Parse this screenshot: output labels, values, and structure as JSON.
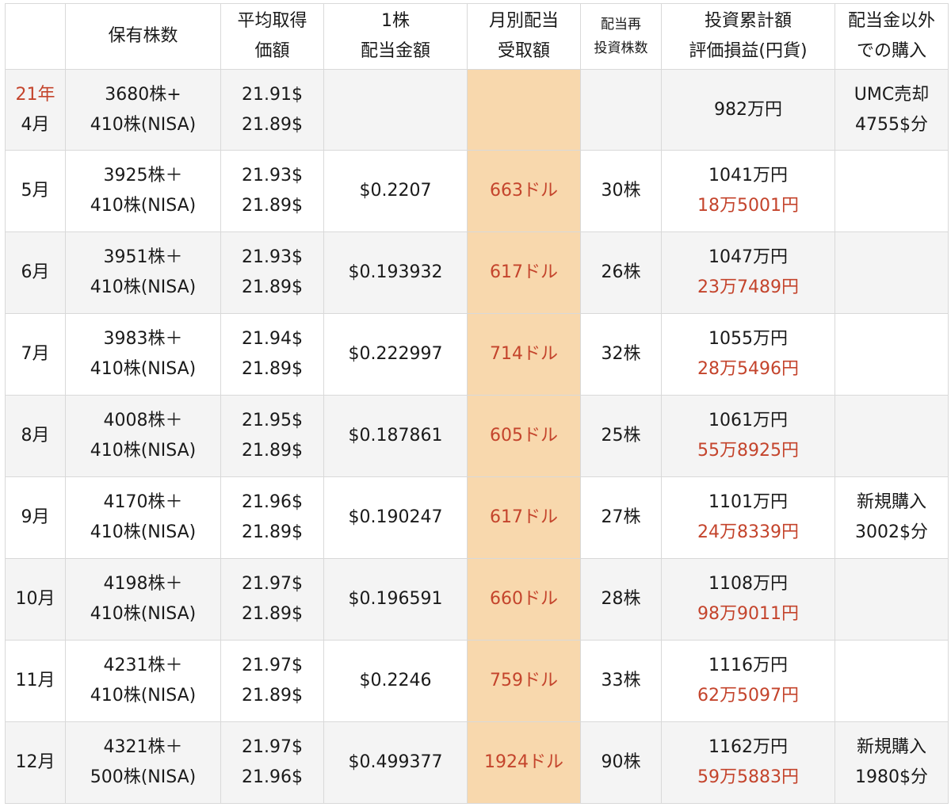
{
  "table": {
    "headers": [
      {
        "lines": [
          ""
        ]
      },
      {
        "lines": [
          "保有株数"
        ]
      },
      {
        "lines": [
          "平均取得",
          "価額"
        ]
      },
      {
        "lines": [
          "1株",
          "配当金額"
        ]
      },
      {
        "lines": [
          "月別配当",
          "受取額"
        ]
      },
      {
        "lines": [
          "配当再",
          "投資株数"
        ]
      },
      {
        "lines": [
          "投資累計額",
          "評価損益(円貨)"
        ]
      },
      {
        "lines": [
          "配当金以外",
          "での購入"
        ]
      }
    ],
    "rows": [
      {
        "month_year": "21年",
        "month": "4月",
        "shares": [
          "3680株+",
          "410株(NISA)"
        ],
        "avg_cost": [
          "21.91$",
          "21.89$"
        ],
        "dividend_per_share": "",
        "monthly_dividend": "",
        "reinvested_shares": "",
        "investment_total": "982万円",
        "unrealized_gain": "",
        "other_purchase": [
          "UMC売却",
          "4755$分"
        ]
      },
      {
        "month": "5月",
        "shares": [
          "3925株＋",
          "410株(NISA)"
        ],
        "avg_cost": [
          "21.93$",
          "21.89$"
        ],
        "dividend_per_share": "$0.2207",
        "monthly_dividend": "663ドル",
        "reinvested_shares": "30株",
        "investment_total": "1041万円",
        "unrealized_gain": "18万5001円",
        "other_purchase": [
          "",
          ""
        ]
      },
      {
        "month": "6月",
        "shares": [
          "3951株＋",
          "410株(NISA)"
        ],
        "avg_cost": [
          "21.93$",
          "21.89$"
        ],
        "dividend_per_share": "$0.193932",
        "monthly_dividend": "617ドル",
        "reinvested_shares": "26株",
        "investment_total": "1047万円",
        "unrealized_gain": "23万7489円",
        "other_purchase": [
          "",
          ""
        ]
      },
      {
        "month": "7月",
        "shares": [
          "3983株＋",
          "410株(NISA)"
        ],
        "avg_cost": [
          "21.94$",
          "21.89$"
        ],
        "dividend_per_share": "$0.222997",
        "monthly_dividend": "714ドル",
        "reinvested_shares": "32株",
        "investment_total": "1055万円",
        "unrealized_gain": "28万5496円",
        "other_purchase": [
          "",
          ""
        ]
      },
      {
        "month": "8月",
        "shares": [
          "4008株＋",
          "410株(NISA)"
        ],
        "avg_cost": [
          "21.95$",
          "21.89$"
        ],
        "dividend_per_share": "$0.187861",
        "monthly_dividend": "605ドル",
        "reinvested_shares": "25株",
        "investment_total": "1061万円",
        "unrealized_gain": "55万8925円",
        "other_purchase": [
          "",
          ""
        ]
      },
      {
        "month": "9月",
        "shares": [
          "4170株＋",
          "410株(NISA)"
        ],
        "avg_cost": [
          "21.96$",
          "21.89$"
        ],
        "dividend_per_share": "$0.190247",
        "monthly_dividend": "617ドル",
        "reinvested_shares": "27株",
        "investment_total": "1101万円",
        "unrealized_gain": "24万8339円",
        "other_purchase": [
          "新規購入",
          "3002$分"
        ]
      },
      {
        "month": "10月",
        "shares": [
          "4198株＋",
          "410株(NISA)"
        ],
        "avg_cost": [
          "21.97$",
          "21.89$"
        ],
        "dividend_per_share": "$0.196591",
        "monthly_dividend": "660ドル",
        "reinvested_shares": "28株",
        "investment_total": "1108万円",
        "unrealized_gain": "98万9011円",
        "other_purchase": [
          "",
          ""
        ]
      },
      {
        "month": "11月",
        "shares": [
          "4231株＋",
          "410株(NISA)"
        ],
        "avg_cost": [
          "21.97$",
          "21.89$"
        ],
        "dividend_per_share": "$0.2246",
        "monthly_dividend": "759ドル",
        "reinvested_shares": "33株",
        "investment_total": "1116万円",
        "unrealized_gain": "62万5097円",
        "other_purchase": [
          "",
          ""
        ]
      },
      {
        "month": "12月",
        "shares": [
          "4321株＋",
          "500株(NISA)"
        ],
        "avg_cost": [
          "21.97$",
          "21.96$"
        ],
        "dividend_per_share": "$0.499377",
        "monthly_dividend": "1924ドル",
        "reinvested_shares": "90株",
        "investment_total": "1162万円",
        "unrealized_gain": "59万5883円",
        "other_purchase": [
          "新規購入",
          "1980$分"
        ]
      }
    ]
  },
  "colors": {
    "accent_red": "#c4442c",
    "highlight_column": "#f8d8ad",
    "zebra_gray": "#f4f4f4",
    "grid": "#d9d9d9"
  }
}
